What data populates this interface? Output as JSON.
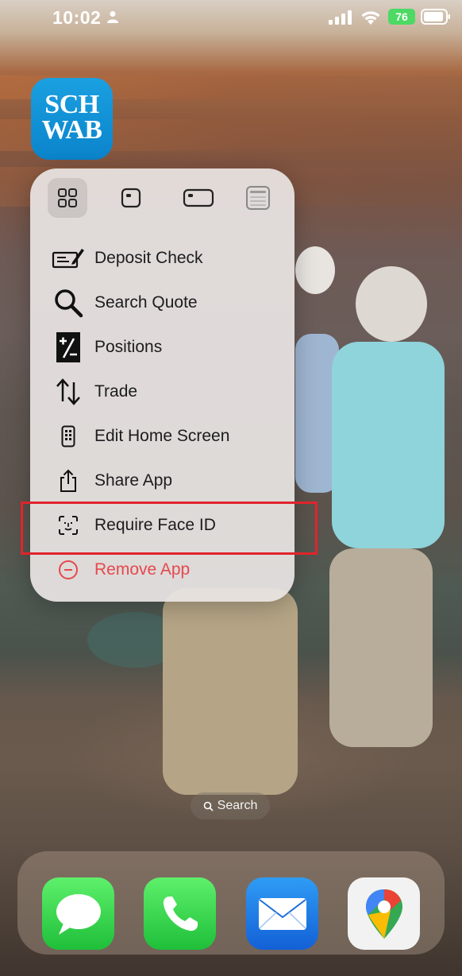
{
  "status_bar": {
    "time": "10:02",
    "battery_level": "76"
  },
  "home_app": {
    "name": "Schwab",
    "icon_line1": "SCH",
    "icon_line2": "WAB"
  },
  "context_menu": {
    "widget_sizes": [
      "grid-icon",
      "small-widget-icon",
      "medium-widget-icon",
      "large-widget-icon"
    ],
    "items": [
      {
        "label": "Deposit Check",
        "icon": "deposit-check-icon"
      },
      {
        "label": "Search Quote",
        "icon": "magnifier-icon"
      },
      {
        "label": "Positions",
        "icon": "positions-icon"
      },
      {
        "label": "Trade",
        "icon": "trade-arrows-icon"
      },
      {
        "label": "Edit Home Screen",
        "icon": "phone-icon"
      },
      {
        "label": "Share App",
        "icon": "share-icon"
      },
      {
        "label": "Require Face ID",
        "icon": "face-id-icon"
      },
      {
        "label": "Remove App",
        "icon": "minus-circle-icon",
        "destructive": true
      }
    ]
  },
  "highlight": {
    "target": "Require Face ID",
    "color": "#e0242c"
  },
  "search_pill": {
    "label": "Search"
  },
  "dock": {
    "apps": [
      "Messages",
      "Phone",
      "Mail",
      "Google Maps"
    ]
  },
  "colors": {
    "schwab_blue": "#0b84cc",
    "destructive_red": "#e5484d",
    "battery_green": "#4cd964"
  }
}
